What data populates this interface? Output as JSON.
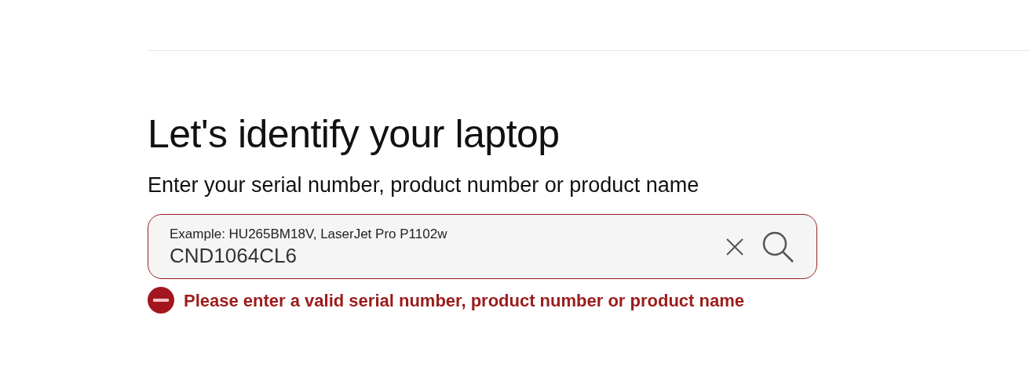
{
  "heading": "Let's identify your laptop",
  "subheading": "Enter your serial number, product number or product name",
  "search": {
    "label": "Example: HU265BM18V, LaserJet Pro P1102w",
    "value": "CND1064CL6",
    "invalid": true
  },
  "error": {
    "message": "Please enter a valid serial number, product number or product name"
  }
}
